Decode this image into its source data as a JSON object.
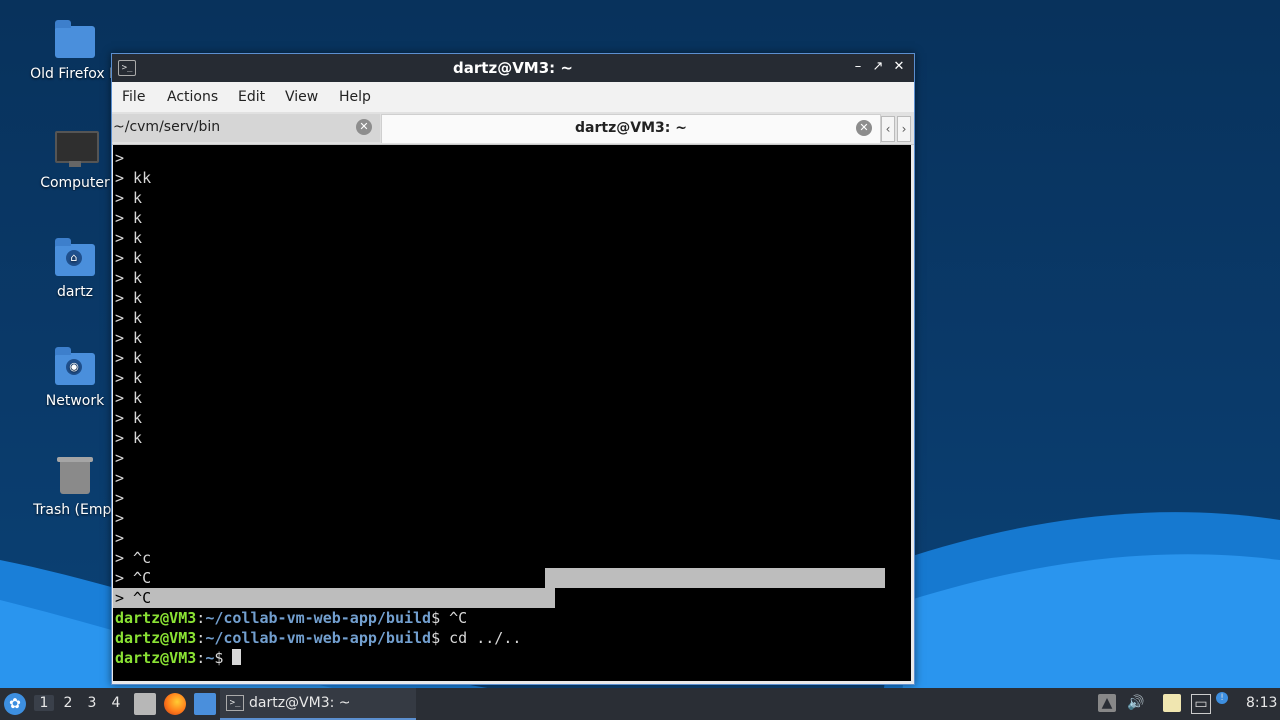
{
  "desktop": {
    "icons": [
      {
        "label": "Old Firefox D",
        "icon": "folder-icon"
      },
      {
        "label": "Computer",
        "icon": "computer-icon"
      },
      {
        "label": "dartz",
        "icon": "home-folder-icon"
      },
      {
        "label": "Network",
        "icon": "network-folder-icon"
      },
      {
        "label": "Trash (Empt",
        "icon": "trash-icon"
      }
    ]
  },
  "window": {
    "title": "dartz@VM3: ~",
    "controls": {
      "minimize": "–",
      "maximize": "↗",
      "close": "✕"
    },
    "menu": [
      "File",
      "Actions",
      "Edit",
      "View",
      "Help"
    ],
    "tabs": [
      {
        "label": "~/cvm/serv/bin",
        "active": false
      },
      {
        "label": "dartz@VM3: ~",
        "active": true
      }
    ]
  },
  "terminal": {
    "lines": [
      ">",
      "> kk",
      "> k",
      "> k",
      "> k",
      "> k",
      "> k",
      "> k",
      "> k",
      "> k",
      "> k",
      "> k",
      "> k",
      "> k",
      "> k",
      ">",
      ">",
      ">",
      ">",
      ">",
      "> ^c",
      "> ^C",
      "> ^C"
    ],
    "prompts": [
      {
        "user": "dartz@VM3",
        "path": "~/collab-vm-web-app/build",
        "cmd": " ^C"
      },
      {
        "user": "dartz@VM3",
        "path": "~/collab-vm-web-app/build",
        "cmd": " cd ../.."
      },
      {
        "user": "dartz@VM3",
        "path": "~",
        "cmd": " "
      }
    ]
  },
  "taskbar": {
    "workspaces": [
      "1",
      "2",
      "3",
      "4"
    ],
    "active_workspace": "1",
    "task_label": "dartz@VM3: ~",
    "clock": "8:13"
  },
  "colors": {
    "title_bar": "#262b33",
    "prompt_user": "#8ae234",
    "prompt_path": "#729fcf",
    "taskbar": "#2a2e35"
  }
}
